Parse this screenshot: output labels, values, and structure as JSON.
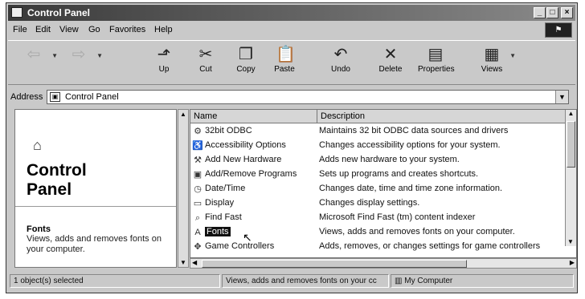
{
  "window": {
    "title": "Control Panel"
  },
  "menu": [
    "File",
    "Edit",
    "View",
    "Go",
    "Favorites",
    "Help"
  ],
  "toolbar": [
    {
      "label": "",
      "icon": "back-arrow-icon",
      "enabled": false
    },
    {
      "label": "",
      "icon": "forward-arrow-icon",
      "enabled": false
    },
    {
      "label": "Up",
      "icon": "up-folder-icon",
      "enabled": true
    },
    {
      "label": "Cut",
      "icon": "scissors-icon",
      "enabled": true
    },
    {
      "label": "Copy",
      "icon": "copy-icon",
      "enabled": true
    },
    {
      "label": "Paste",
      "icon": "paste-icon",
      "enabled": true
    },
    {
      "label": "Undo",
      "icon": "undo-icon",
      "enabled": true
    },
    {
      "label": "Delete",
      "icon": "delete-x-icon",
      "enabled": true
    },
    {
      "label": "Properties",
      "icon": "properties-icon",
      "enabled": true
    },
    {
      "label": "Views",
      "icon": "views-icon",
      "enabled": true
    }
  ],
  "address": {
    "label": "Address",
    "value": "Control Panel"
  },
  "leftpane": {
    "title_line1": "Control",
    "title_line2": "Panel",
    "selected_name": "Fonts",
    "selected_desc": "Views, adds and removes fonts on your computer."
  },
  "list": {
    "columns": [
      "Name",
      "Description"
    ],
    "items": [
      {
        "name": "32bit ODBC",
        "desc": "Maintains 32 bit ODBC data sources and drivers",
        "selected": false
      },
      {
        "name": "Accessibility Options",
        "desc": "Changes accessibility options for your system.",
        "selected": false
      },
      {
        "name": "Add New Hardware",
        "desc": "Adds new hardware to your system.",
        "selected": false
      },
      {
        "name": "Add/Remove Programs",
        "desc": "Sets up programs and creates shortcuts.",
        "selected": false
      },
      {
        "name": "Date/Time",
        "desc": "Changes date, time and time zone information.",
        "selected": false
      },
      {
        "name": "Display",
        "desc": "Changes display settings.",
        "selected": false
      },
      {
        "name": "Find Fast",
        "desc": "Microsoft Find Fast (tm) content indexer",
        "selected": false
      },
      {
        "name": "Fonts",
        "desc": "Views, adds and removes fonts on your computer.",
        "selected": true
      },
      {
        "name": "Game Controllers",
        "desc": "Adds, removes, or changes settings for game controllers",
        "selected": false
      }
    ]
  },
  "status": {
    "left": "1 object(s) selected",
    "middle": "Views, adds and removes fonts on your cc",
    "right": "My Computer"
  }
}
